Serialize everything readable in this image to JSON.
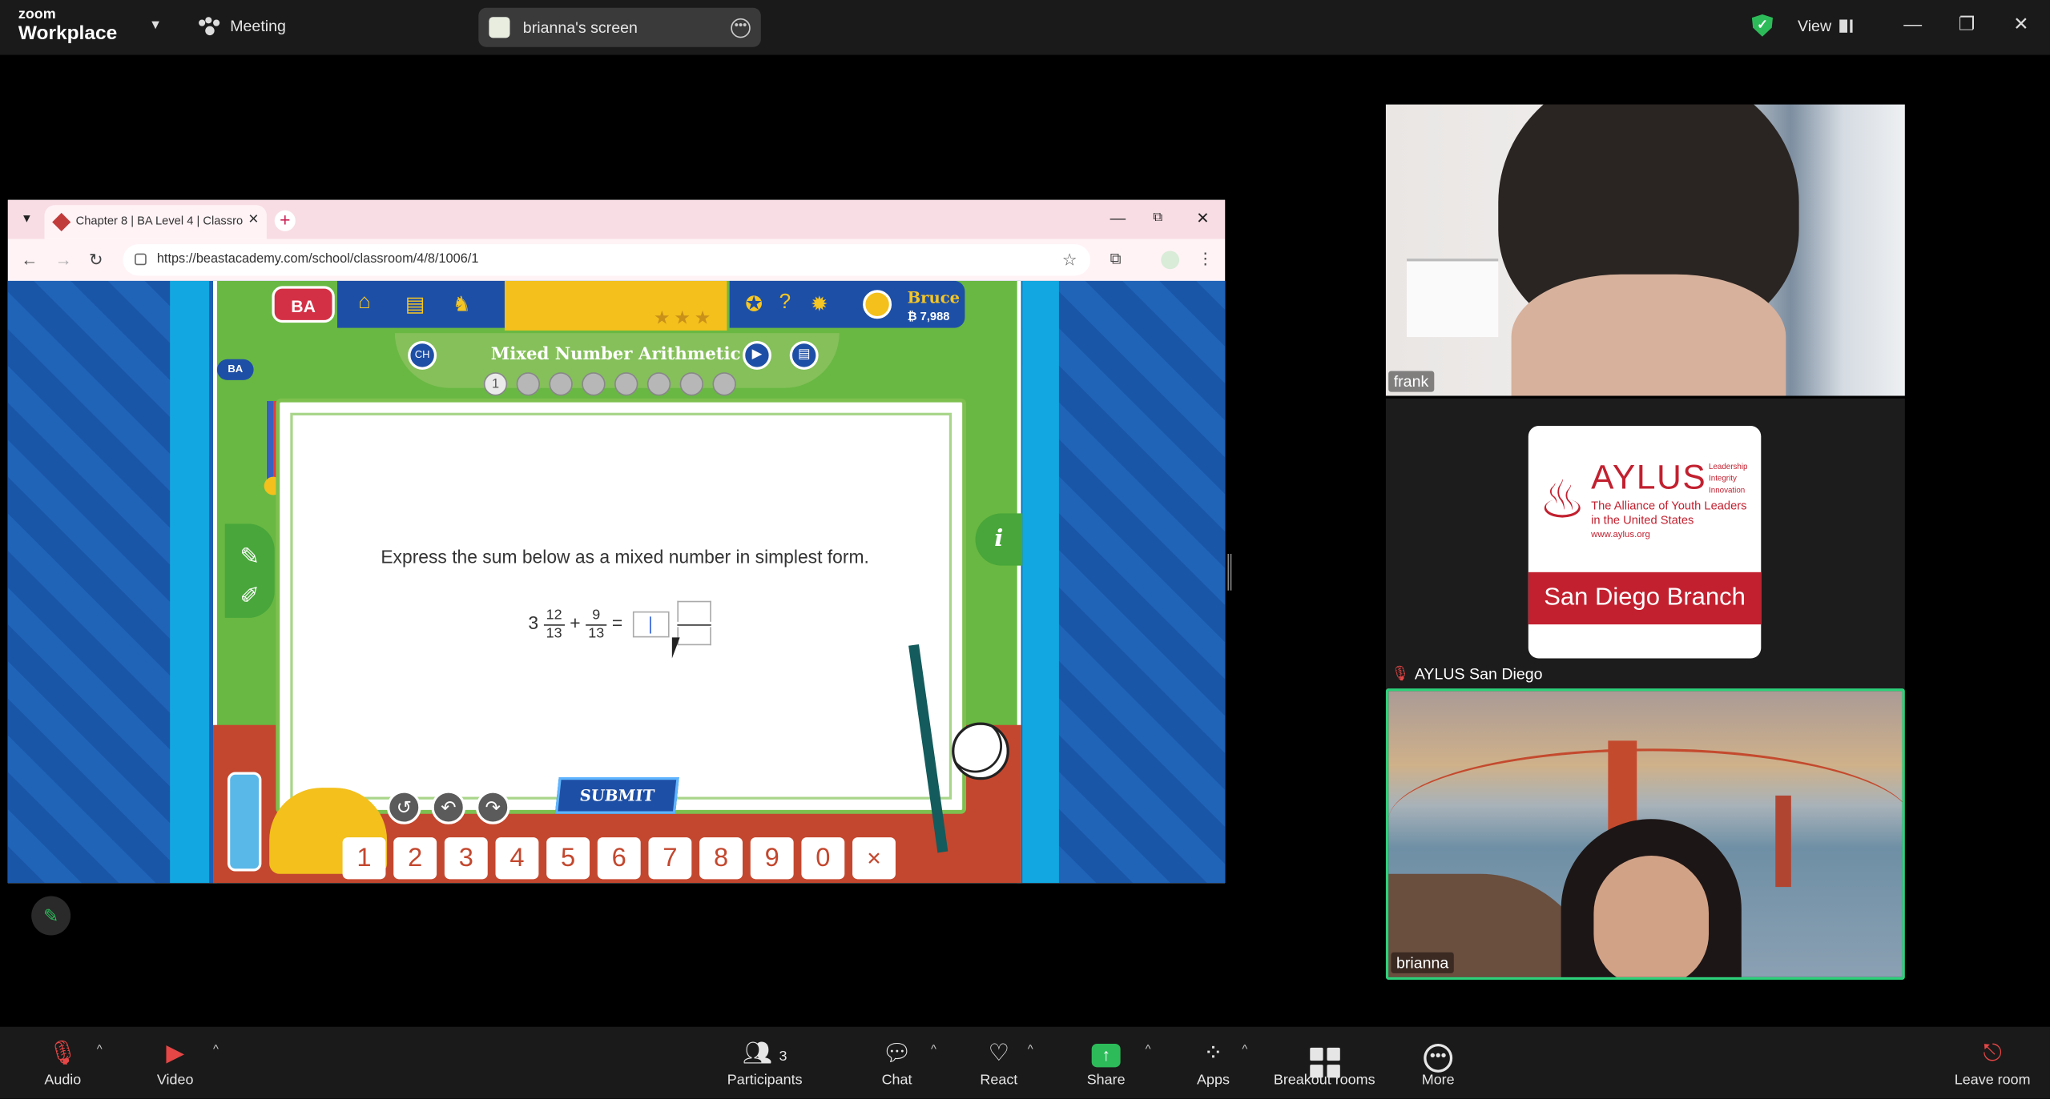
{
  "zoom": {
    "logo_small": "zoom",
    "logo_big": "Workplace",
    "meeting_label": "Meeting",
    "shared_screen_label": "brianna's screen",
    "view_label": "View",
    "security_color": "#2dbb5a"
  },
  "browser": {
    "tab_title": "Chapter 8 | BA Level 4 | Classro",
    "url": "https://beastacademy.com/school/classroom/4/8/1006/1"
  },
  "game": {
    "logo": "BA",
    "user_name": "Bruce",
    "user_bucks": "₿ 7,988",
    "lesson_title": "Mixed Number Arithmetic",
    "progress_current": "1",
    "prompt": "Express the sum below as a mixed number in simplest form.",
    "equation": {
      "whole": "3",
      "num1": "12",
      "den1": "13",
      "plus": "+",
      "num2": "9",
      "den2": "13",
      "equals": "="
    },
    "submit_label": "SUBMIT",
    "info_label": "i",
    "keypad": [
      "1",
      "2",
      "3",
      "4",
      "5",
      "6",
      "7",
      "8",
      "9",
      "0"
    ],
    "keypad_delete": "✕"
  },
  "participants": {
    "tiles": [
      {
        "name": "frank"
      },
      {
        "name": "AYLUS San Diego"
      },
      {
        "name": "brianna"
      }
    ],
    "aylus_card": {
      "title": "AYLUS",
      "tagline": [
        "Leadership",
        "Integrity",
        "Innovation"
      ],
      "subtitle_1": "The Alliance of Youth Leaders",
      "subtitle_2": "in the United States",
      "url": "www.aylus.org",
      "branch": "San Diego Branch",
      "brand_color": "#c2202f"
    }
  },
  "toolbar": {
    "audio": "Audio",
    "video": "Video",
    "participants_count": "3",
    "participants": "Participants",
    "chat": "Chat",
    "react": "React",
    "share": "Share",
    "apps": "Apps",
    "breakout": "Breakout rooms",
    "more": "More",
    "leave": "Leave room"
  }
}
